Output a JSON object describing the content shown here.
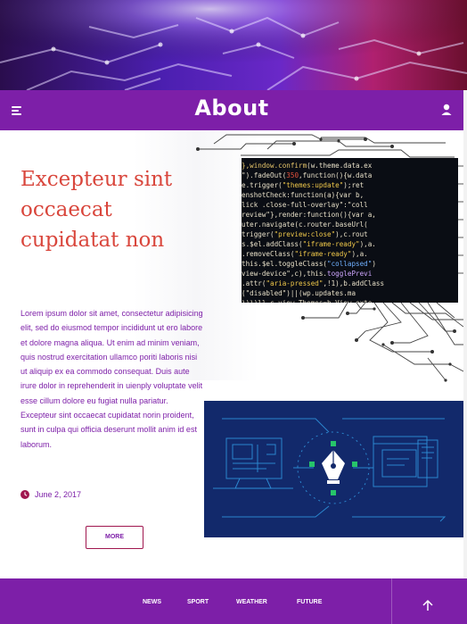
{
  "header": {
    "title": "About",
    "menu_icon": "menu-icon",
    "user_icon": "user-icon"
  },
  "article": {
    "headline": "Excepteur sint occaecat cupidatat non",
    "body": "Lorem ipsum dolor sit amet, consectetur adipisicing elit, sed do eiusmod tempor incididunt ut ero labore et dolore magna aliqua. Ut enim ad minim veniam, quis nostrud exercitation ullamco poriti laboris nisi ut aliquip ex ea commodo consequat. Duis aute irure dolor in reprehenderit in uienply voluptate velit esse cillum dolore eu fugiat nulla pariatur. Excepteur sint occaecat cupidatat norin proident, sunt in culpa qui officia deserunt mollit anim id est laborum.",
    "date": "June 2, 2017",
    "more_label": "MORE"
  },
  "footer": {
    "nav": [
      "NEWS",
      "SPORT",
      "WEATHER",
      "FUTURE"
    ],
    "scroll_top_icon": "arrow-up-icon"
  },
  "colors": {
    "brand_purple": "#7d1fa8",
    "headline_red": "#d9463c",
    "more_border": "#a0174f",
    "illustration_navy": "#12296b"
  }
}
